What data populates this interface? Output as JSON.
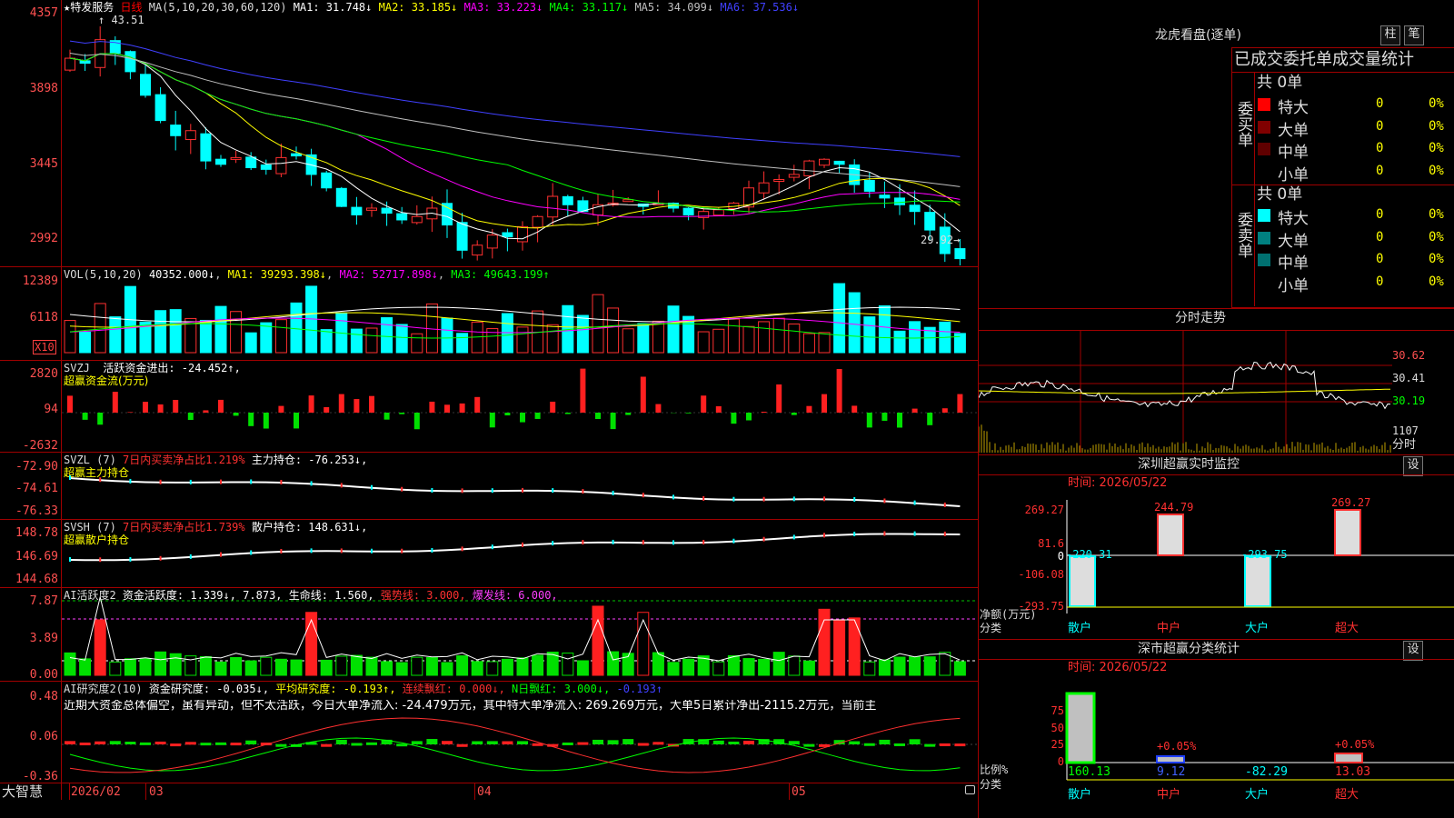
{
  "stock": {
    "name": "特发服务",
    "period": "日线",
    "high_marker": "43.51",
    "low_marker": "29.92"
  },
  "kline": {
    "ma_header": "MA(5,10,20,30,60,120)",
    "ma": [
      {
        "label": "MA1: 31.748↓",
        "color": "#ffffff"
      },
      {
        "label": "MA2: 33.185↓",
        "color": "#ffff00"
      },
      {
        "label": "MA3: 33.223↓",
        "color": "#ff00ff"
      },
      {
        "label": "MA4: 33.117↓",
        "color": "#00ff00"
      },
      {
        "label": "MA5: 34.099↓",
        "color": "#c0c0c0"
      },
      {
        "label": "MA6: 37.536↓",
        "color": "#4040ff"
      }
    ],
    "ylabels": [
      "4357",
      "3898",
      "3445",
      "2992"
    ]
  },
  "vol": {
    "header": "VOL(5,10,20)",
    "value": "40352.000↓",
    "ma1": "MA1: 39293.398↓",
    "ma2": "MA2: 52717.898↓",
    "ma3": "MA3: 49643.199↑",
    "ylabels": [
      "12389",
      "6118"
    ],
    "unit": "X10"
  },
  "svzj": {
    "header": "SVZJ",
    "line1": "活跃资金进出: -24.452↑,",
    "line2": "超赢资金流(万元)",
    "ylabels": [
      "2820",
      "94",
      "-2632"
    ]
  },
  "svzl": {
    "header": "SVZL (7)",
    "p1": "7日内买卖净占比1.219%",
    "p2": "主力持仓: -76.253↓,",
    "line2": "超赢主力持仓",
    "ylabels": [
      "-72.90",
      "-74.61",
      "-76.33"
    ]
  },
  "svsh": {
    "header": "SVSH (7)",
    "p1": "7日内买卖净占比1.739%",
    "p2": "散户持仓: 148.631↓,",
    "line2": "超赢散户持仓",
    "ylabels": [
      "148.78",
      "146.69",
      "144.68"
    ]
  },
  "ai1": {
    "header": "AI活跃度2",
    "p1": "资金活跃度: 1.339↓, 7.873,",
    "p2": "生命线: 1.560,",
    "p3": "强势线: 3.000,",
    "p4": "爆发线: 6.000,",
    "ylabels": [
      "7.87",
      "3.89",
      "0.00"
    ]
  },
  "ai2": {
    "header": "AI研究度2(10)",
    "p1": "资金研究度: -0.035↓,",
    "p2": "平均研究度: -0.193↑,",
    "p3": "连续飘红: 0.000↓,",
    "p4": "N日飘红: 3.000↓,",
    "p5": "-0.193↑",
    "comment": "近期大资金总体偏空，虽有异动，但不太活跃，今日大单净流入: -24.479万元，其中特大单净流入: 269.269万元，大单5日累计净出-2115.2万元，当前主",
    "ylabels": [
      "0.48",
      "0.06",
      "-0.36"
    ]
  },
  "dates": {
    "left": "大智慧",
    "d1": "2026/02",
    "d2": "03",
    "d3": "04",
    "d4": "05"
  },
  "right": {
    "lhb_title": "龙虎看盘(逐单)",
    "btn_zhu": "柱",
    "btn_bi": "笔",
    "stats_title": "已成交委托单成交量统计",
    "buy_group": "委买单",
    "sell_group": "委卖单",
    "buy_total": "共 0单",
    "sell_total": "共 0单",
    "buy_rows": [
      {
        "label": "特大",
        "count": "0",
        "pct": "0%",
        "color": "#ff0000"
      },
      {
        "label": "大单",
        "count": "0",
        "pct": "0%",
        "color": "#800000"
      },
      {
        "label": "中单",
        "count": "0",
        "pct": "0%",
        "color": "#600000"
      },
      {
        "label": "小单",
        "count": "0",
        "pct": "0%",
        "color": ""
      }
    ],
    "sell_rows": [
      {
        "label": "特大",
        "count": "0",
        "pct": "0%",
        "color": "#00ffff"
      },
      {
        "label": "大单",
        "count": "0",
        "pct": "0%",
        "color": "#008080"
      },
      {
        "label": "中单",
        "count": "0",
        "pct": "0%",
        "color": "#007070"
      },
      {
        "label": "小单",
        "count": "0",
        "pct": "0%",
        "color": ""
      }
    ],
    "fs_title": "分时走势",
    "fs_ylabels": [
      "30.62",
      "30.41",
      "30.19",
      "1107",
      "分时"
    ],
    "mon_title": "深圳超赢实时监控",
    "mon_btn": "设",
    "mon_time": "时间: 2026/05/22",
    "mon_ylabels": [
      "269.27",
      "81.6",
      "0",
      "-106.08",
      "-293.75"
    ],
    "mon_values": [
      {
        "cat": "散户",
        "val": "-220.31"
      },
      {
        "cat": "中户",
        "val": "244.79"
      },
      {
        "cat": "大户",
        "val": "-293.75"
      },
      {
        "cat": "超大",
        "val": "269.27"
      }
    ],
    "mon_axis": "净额(万元)",
    "mon_axis2": "分类",
    "cls_title": "深市超赢分类统计",
    "cls_btn": "设",
    "cls_time": "时间: 2026/05/22",
    "cls_ylabels": [
      "75",
      "50",
      "25",
      "0"
    ],
    "cls_values": [
      {
        "cat": "散户",
        "val": "160.13",
        "pct": ""
      },
      {
        "cat": "中户",
        "val": "9.12",
        "pct": "+0.05%"
      },
      {
        "cat": "大户",
        "val": "-82.29",
        "pct": ""
      },
      {
        "cat": "超大",
        "val": "13.03",
        "pct": "+0.05%"
      }
    ],
    "cls_axis": "比例%",
    "cls_axis2": "分类"
  }
}
